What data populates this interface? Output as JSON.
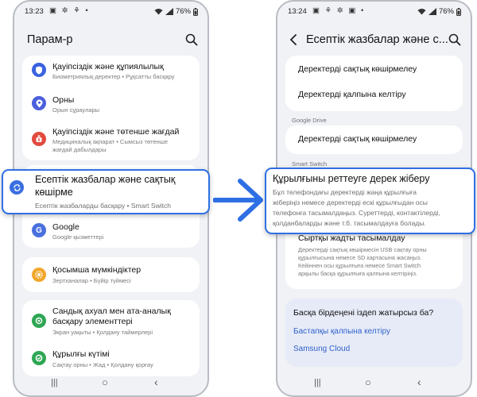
{
  "left": {
    "status": {
      "time": "13:23",
      "notifs": "▣ ✲ ⚘ •",
      "battery": "76%"
    },
    "title": "Парам-р",
    "items": [
      {
        "icon": "shield-icon",
        "color": "#3a63e0",
        "title": "Қауіпсіздік және құпиялылық",
        "subtitle": "Биометриялық деректер • Рұқсатты басқару"
      },
      {
        "icon": "location-icon",
        "color": "#4b5fde",
        "title": "Орны",
        "subtitle": "Орын сұраулары"
      },
      {
        "icon": "alert-icon",
        "color": "#e24a3e",
        "title": "Қауіпсіздік және төтенше жағдай",
        "subtitle1": "Медициналық ақпарат • Сымсыз төтенше",
        "subtitle2": "жағдай дабылдары"
      },
      {
        "icon": "google-icon",
        "color": "#4a70df",
        "title": "Google",
        "subtitle": "Google қызметтері"
      },
      {
        "icon": "accessibility-icon",
        "color": "#f2a62a",
        "title": "Қосымша мүмкіндіктер",
        "subtitle": "Зертханалар • Бүйір түймесі"
      },
      {
        "icon": "wellbeing-icon",
        "color": "#2ea653",
        "title1": "Сандық ахуал мен ата-аналық",
        "title2": "басқару элементтері",
        "subtitle": "Экран уақыты • Қолдану таймерлері"
      },
      {
        "icon": "device-care-icon",
        "color": "#2ea653",
        "title": "Құрылғы күтімі",
        "subtitle": "Сақтау орны • Жад • Қолдану қорғау"
      }
    ],
    "callout": {
      "title1": "Есептік жазбалар және сақтық",
      "title2": "көшірме",
      "subtitle": "Есептік жазбаларды басқару • Smart Switch"
    }
  },
  "right": {
    "status": {
      "time": "13:24",
      "notifs": "▣ ⚘ ✲ ▣ •",
      "battery": "76%"
    },
    "title": "Есептік жазбалар және с...",
    "items": {
      "backup": "Деректерді сақтық көшірмелеу",
      "restore": "Деректерді қалпына келтіру",
      "google_drive_header": "Google Drive",
      "gd_backup": "Деректерді сақтық көшірмелеу",
      "smart_switch_header": "Smart Switch",
      "ext_title": "Сыртқы жадты тасымалдау",
      "ext_desc1": "Деректерді сақтық көшірмесін USB сақтау орны",
      "ext_desc2": "құрылғысына немесе SD картасына жасаңыз.",
      "ext_desc3": "Кейіннен осы құрылғыға немесе Smart Switch",
      "ext_desc4": "арқылы басқа құрылғыға қалпына келтіріңіз."
    },
    "callout": {
      "title": "Құрылғыны реттеуге дерек жіберу",
      "desc1": "Бұл телефондағы деректерді жаңа құрылғыға",
      "desc2": "жіберіңіз немесе деректерді ескі құрылғыдан осы",
      "desc3": "телефонға тасымалдаңыз. Суреттерді, контактілерді,",
      "desc4": "қолданбаларды және т.б. тасымалдауға болады."
    },
    "suggest": {
      "title": "Басқа бірдеңені іздеп жатырсыз ба?",
      "link1": "Бастапқы қалпына келтіру",
      "link2": "Samsung Cloud"
    }
  },
  "colors": {
    "accent": "#2f6fe4",
    "link": "#2f62c9",
    "suggest_bg": "#e7ebf8"
  },
  "nav": {
    "recents": "|||",
    "home": "○",
    "back": "‹"
  }
}
